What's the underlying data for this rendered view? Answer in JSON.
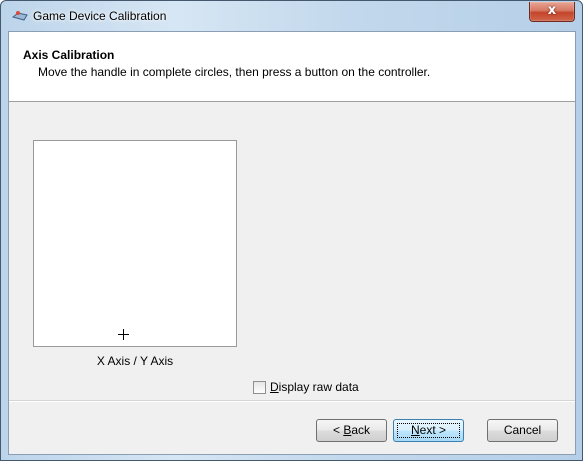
{
  "window": {
    "title": "Game Device Calibration",
    "close_glyph": "x"
  },
  "header": {
    "title": "Axis Calibration",
    "subtitle": "Move the handle in complete circles, then press a button on the controller."
  },
  "axis_panel": {
    "label": "X Axis / Y Axis",
    "cursor_glyph": "+"
  },
  "options": {
    "raw_data_label": "Display raw data",
    "raw_data_checked": false
  },
  "buttons": {
    "back": "< Back",
    "next": "Next >",
    "cancel": "Cancel"
  },
  "icons": {
    "title_icon": "joystick-icon",
    "close_icon": "close-icon",
    "crosshair": "crosshair-icon"
  }
}
